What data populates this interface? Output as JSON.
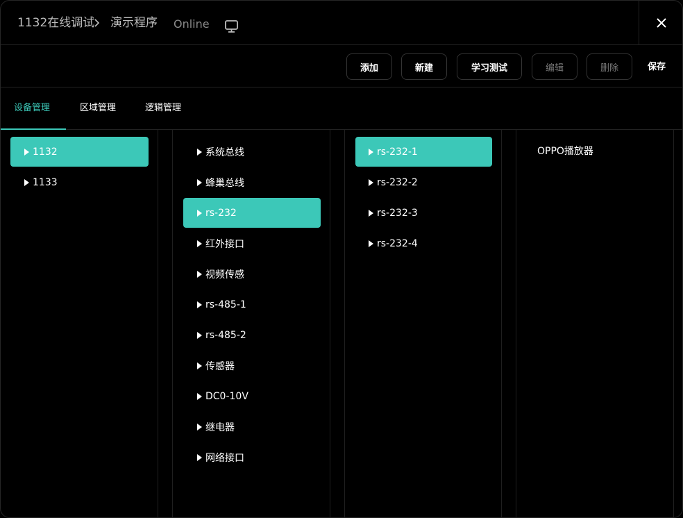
{
  "header": {
    "crumb1": "1132在线调试",
    "separator": ">",
    "crumb2": "演示程序",
    "status": "Online"
  },
  "toolbar": {
    "add": "添加",
    "new": "新建",
    "learn_test": "学习测试",
    "edit": "编辑",
    "delete": "删除",
    "save": "保存"
  },
  "tabs": [
    "设备管理",
    "区域管理",
    "逻辑管理"
  ],
  "columns": {
    "devices": [
      "1132",
      "1133"
    ],
    "interfaces": [
      "系统总线",
      "蜂巢总线",
      "rs-232",
      "红外接口",
      "视频传感",
      "rs-485-1",
      "rs-485-2",
      "传感器",
      "DC0-10V",
      "继电器",
      "网络接口"
    ],
    "ports": [
      "rs-232-1",
      "rs-232-2",
      "rs-232-3",
      "rs-232-4"
    ],
    "equipment": [
      "OPPO播放器"
    ]
  },
  "colors": {
    "accent": "#3cc8b8",
    "background": "#000000"
  }
}
